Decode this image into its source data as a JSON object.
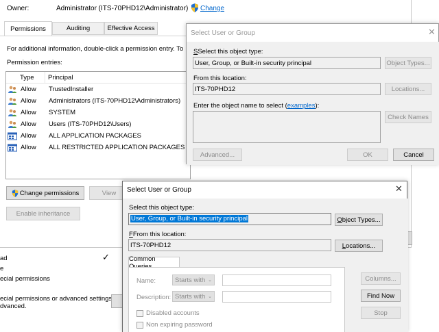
{
  "owner": {
    "label": "Owner:",
    "value": "Administrator (ITS-70PHD12\\Administrator)",
    "change_link": "Change"
  },
  "tabs": [
    "Permissions",
    "Auditing",
    "Effective Access"
  ],
  "info_text": "For additional information, double-click a permission entry. To",
  "entries_label": "Permission entries:",
  "columns": {
    "type": "Type",
    "principal": "Principal"
  },
  "entries": [
    {
      "type": "Allow",
      "principal": "TrustedInstaller",
      "icon": "user-group-icon"
    },
    {
      "type": "Allow",
      "principal": "Administrators (ITS-70PHD12\\Administrators)",
      "icon": "user-group-icon"
    },
    {
      "type": "Allow",
      "principal": "SYSTEM",
      "icon": "user-group-icon"
    },
    {
      "type": "Allow",
      "principal": "Users (ITS-70PHD12\\Users)",
      "icon": "user-group-icon"
    },
    {
      "type": "Allow",
      "principal": "ALL APPLICATION PACKAGES",
      "icon": "app-package-icon"
    },
    {
      "type": "Allow",
      "principal": "ALL RESTRICTED APPLICATION PACKAGES",
      "icon": "app-package-icon"
    }
  ],
  "buttons": {
    "change_permissions": "Change permissions",
    "view": "View",
    "enable_inheritance": "Enable inheritance"
  },
  "background_fragments": [
    "ad",
    "e",
    "ecial permissions",
    "ecial permissions or advanced settings,",
    "dvanced."
  ],
  "dialog1": {
    "title": "Select User or Group",
    "object_type_label": "Select this object type:",
    "object_type_value": "User, Group, or Built-in security principal",
    "object_types_button": "Object Types...",
    "location_label": "From this location:",
    "location_value": "ITS-70PHD12",
    "locations_button": "Locations...",
    "enter_label_prefix": "Enter the object name to select (",
    "enter_label_link": "examples",
    "enter_label_suffix": "):",
    "check_names_button": "Check Names",
    "advanced_button": "Advanced...",
    "ok_button": "OK",
    "cancel_button": "Cancel"
  },
  "dialog2": {
    "title": "Select User or Group",
    "object_type_label": "Select this object type:",
    "object_type_value": "User, Group, or Built-in security principal",
    "object_types_button": "Object Types...",
    "location_label": "From this location:",
    "location_value": "ITS-70PHD12",
    "locations_button": "Locations...",
    "common_queries_tab": "Common Queries",
    "name_label": "Name:",
    "name_mode": "Starts with",
    "description_label": "Description:",
    "description_mode": "Starts with",
    "disabled_accounts": "Disabled accounts",
    "non_expiring_password": "Non expiring password",
    "columns_button": "Columns...",
    "find_now_button": "Find Now",
    "stop_button": "Stop"
  }
}
